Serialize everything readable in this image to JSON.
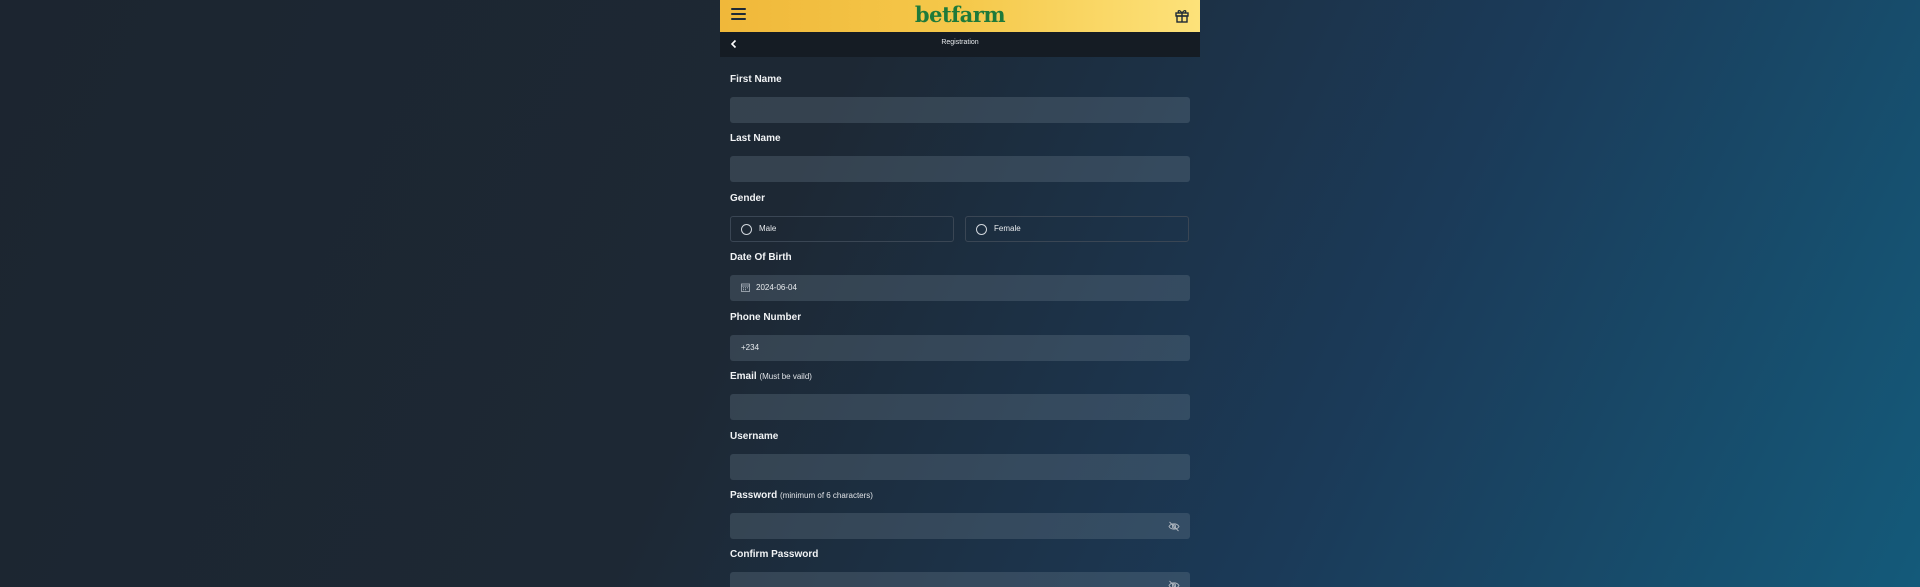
{
  "header": {
    "logo_text": "betfarm",
    "menu_icon": "menu-icon",
    "gift_icon": "gift-icon"
  },
  "subheader": {
    "title": "Registration",
    "back_icon": "chevron-left-icon"
  },
  "form": {
    "first_name": {
      "label": "First Name",
      "value": ""
    },
    "last_name": {
      "label": "Last Name",
      "value": ""
    },
    "gender": {
      "label": "Gender",
      "options": [
        "Male",
        "Female"
      ]
    },
    "dob": {
      "label": "Date Of Birth",
      "value": "2024-06-04"
    },
    "phone": {
      "label": "Phone Number",
      "value": "+234"
    },
    "email": {
      "label": "Email",
      "hint": "(Must be vaild)",
      "value": ""
    },
    "username": {
      "label": "Username",
      "value": ""
    },
    "password": {
      "label": "Password",
      "hint": "(minimum of 6 characters)",
      "value": ""
    },
    "confirm_password": {
      "label": "Confirm Password",
      "value": ""
    }
  },
  "colors": {
    "header_gradient_start": "#f0b83a",
    "header_gradient_end": "#fde27a",
    "logo": "#1f7a3a",
    "subheader_bg": "#151c24"
  }
}
